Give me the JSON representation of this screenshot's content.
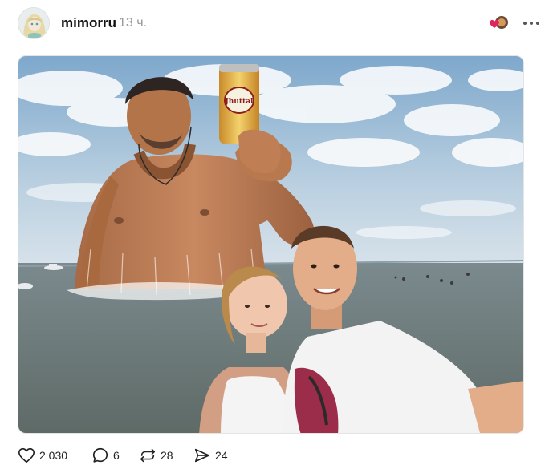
{
  "post": {
    "username": "mimorru",
    "time": "13 ч."
  },
  "photo": {
    "can_label": "Jhuttal"
  },
  "actions": {
    "likes": "2 030",
    "replies": "6",
    "reposts": "28",
    "shares": "24"
  },
  "icons": {
    "avatar": "avatar-anime-girl",
    "reactors": "heart-with-avatar-icon",
    "more": "more-dots-icon",
    "like": "heart-icon",
    "reply": "comment-icon",
    "repost": "repost-icon",
    "share": "send-icon"
  },
  "colors": {
    "accent_heart": "#e0245e",
    "text_muted": "#999999",
    "sky": "#8fb4d4",
    "sea": "#6d7b7a"
  }
}
